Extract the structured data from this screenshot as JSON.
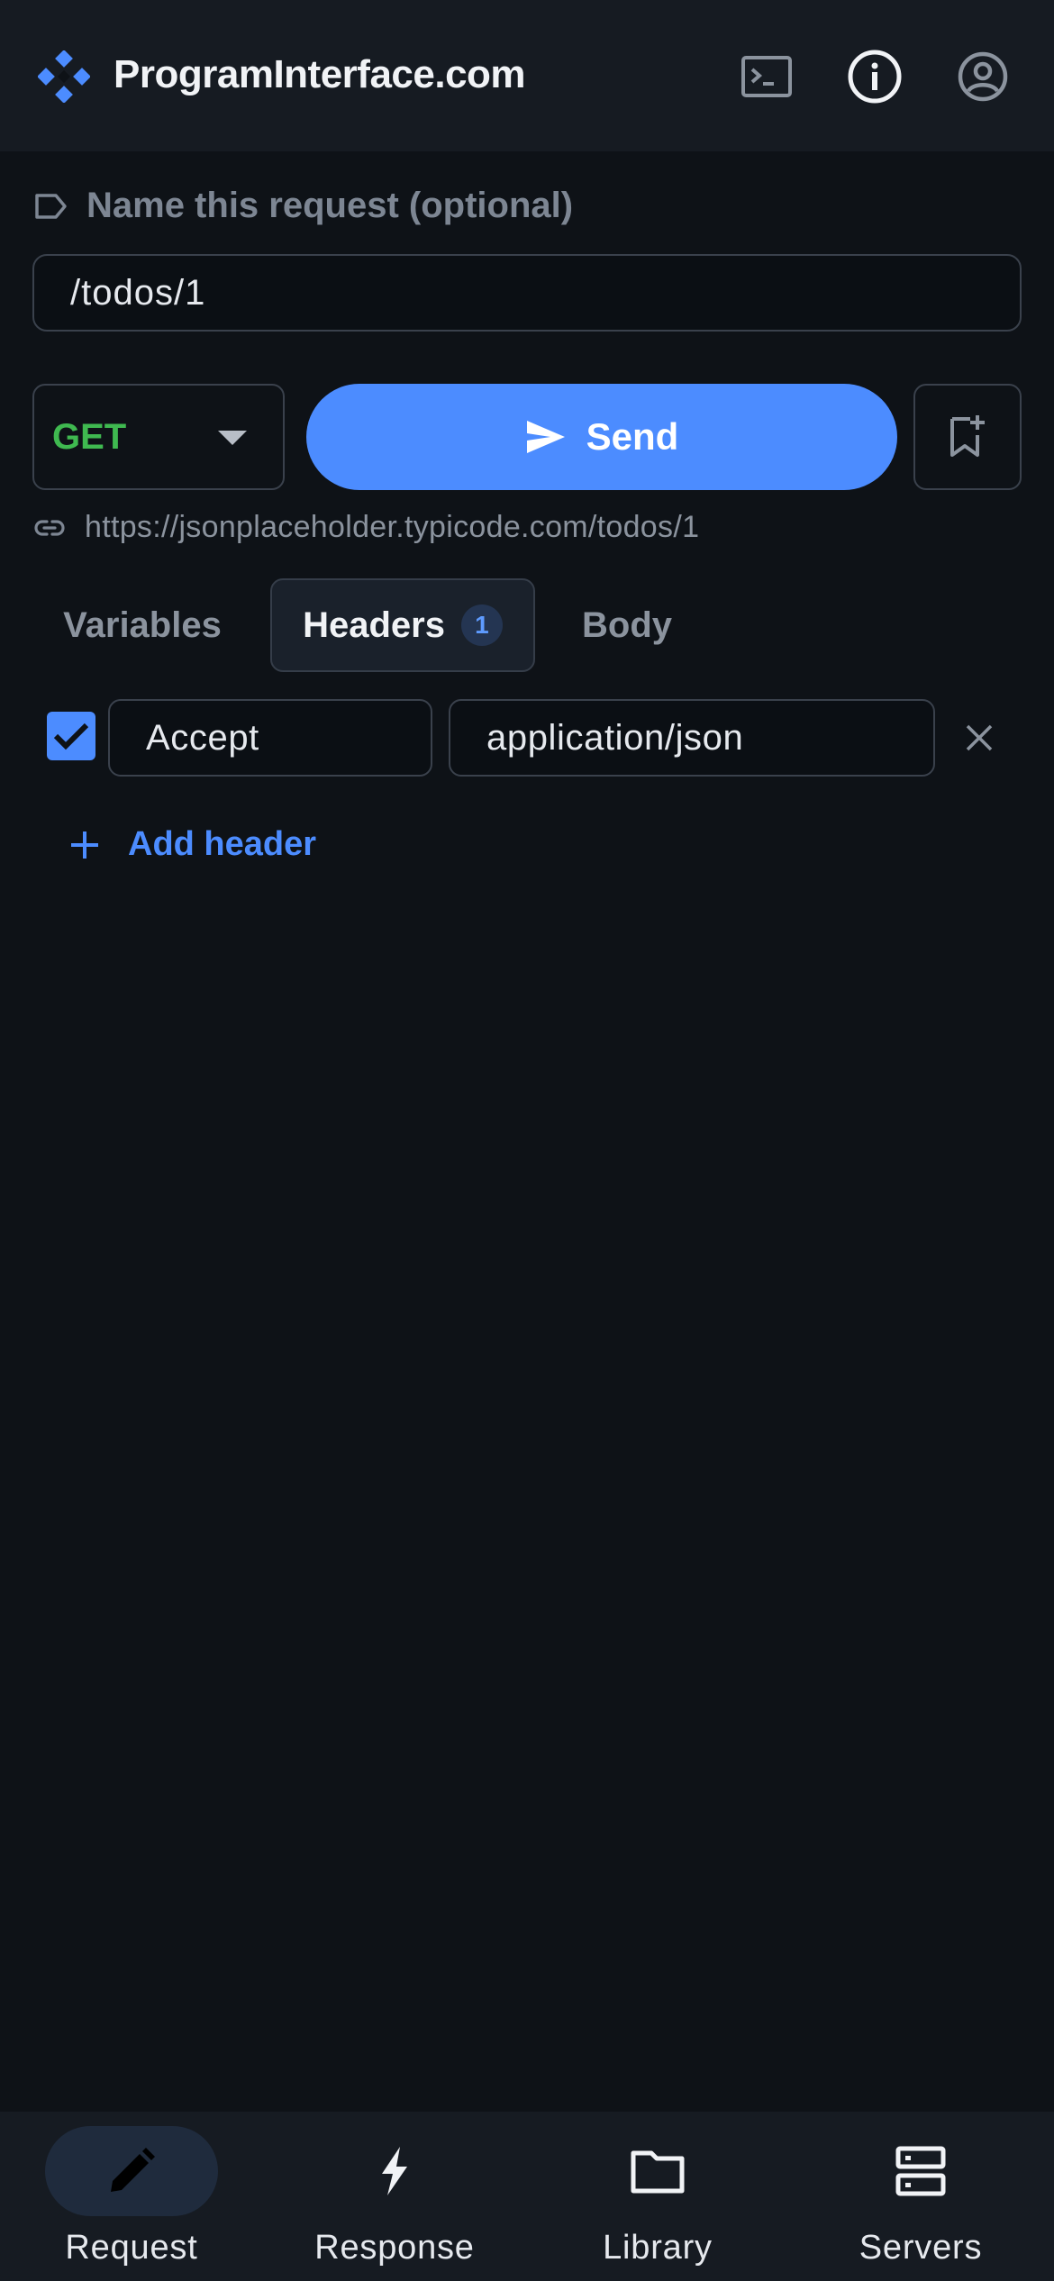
{
  "app": {
    "brand": "ProgramInterface.com"
  },
  "header_icons": [
    "terminal-icon",
    "info-icon",
    "account-icon"
  ],
  "request": {
    "name_placeholder": "Name this request (optional)",
    "path": "/todos/1",
    "method": "GET",
    "send_label": "Send",
    "full_url": "https://jsonplaceholder.typicode.com/todos/1"
  },
  "tabs": [
    {
      "label": "Variables",
      "active": false
    },
    {
      "label": "Headers",
      "active": true,
      "badge": "1"
    },
    {
      "label": "Body",
      "active": false
    }
  ],
  "headers": [
    {
      "enabled": true,
      "key": "Accept",
      "value": "application/json"
    }
  ],
  "add_header_label": "Add header",
  "bottom_nav": [
    {
      "label": "Request",
      "icon": "pencil-icon",
      "active": true
    },
    {
      "label": "Response",
      "icon": "lightning-icon",
      "active": false
    },
    {
      "label": "Library",
      "icon": "folder-icon",
      "active": false
    },
    {
      "label": "Servers",
      "icon": "server-icon",
      "active": false
    }
  ],
  "colors": {
    "accent": "#4c8cff",
    "method_get": "#3fb950",
    "background": "#0e1217",
    "surface": "#161b22"
  }
}
